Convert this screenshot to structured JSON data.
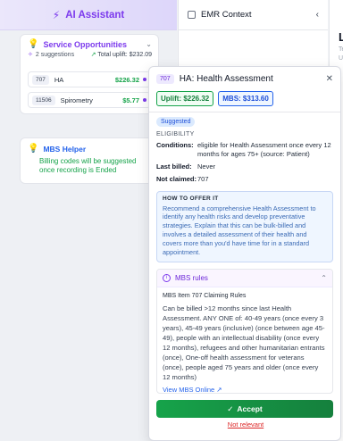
{
  "assistant": {
    "title": "AI Assistant",
    "opportunities": {
      "title": "Service Opportunities",
      "suggestions": "2 suggestions",
      "total_uplift": "Total uplift: $232.09",
      "items": [
        {
          "code": "707",
          "name": "HA",
          "amount": "$226.32"
        },
        {
          "code": "11506",
          "name": "Spirometry",
          "amount": "$5.77"
        }
      ]
    },
    "mbs_helper": {
      "title": "MBS Helper",
      "text": "Billing codes will be suggested once recording is Ended"
    }
  },
  "emr": {
    "title": "EMR Context",
    "partial_heading": "L",
    "partial_line1": "Te",
    "partial_line2": "Un"
  },
  "popup": {
    "code": "707",
    "title": "HA: Health Assessment",
    "uplift": "Uplift: $226.32",
    "mbs": "MBS: $313.60",
    "status": "Suggested",
    "eligibility_label": "ELIGIBILITY",
    "conditions_label": "Conditions:",
    "conditions_value": "eligible for Health Assessment once every 12 months for ages 75+ (source: Patient)",
    "last_billed_label": "Last billed:",
    "last_billed_value": "Never",
    "not_claimed_label": "Not claimed:",
    "not_claimed_value": "707",
    "how_to_label": "HOW TO OFFER IT",
    "how_to_text": "Recommend a comprehensive Health Assessment to identify any health risks and develop preventative strategies. Explain that this can be bulk-billed and involves a detailed assessment of their health and covers more than you'd have time for in a standard appointment.",
    "rules_title": "MBS rules",
    "rules_subtitle": "MBS Item 707 Claiming Rules",
    "rules_body": "Can be billed >12 months since last Health Assessment. ANY ONE of: 40-49 years (once every 3 years), 45-49 years (inclusive) (once between age 45-49), people with an intellectual disability (once every 12 months), refugees and other humanitarian entrants (once), One-off health assessment for veterans (once), people aged 75 years and older (once every 12 months)",
    "view_link": "View MBS Online",
    "accept": "Accept",
    "not_relevant": "Not relevant"
  },
  "colors": {
    "accent": "#7c3aed",
    "success": "#16a34a",
    "link": "#2563eb",
    "danger": "#dc2626"
  }
}
